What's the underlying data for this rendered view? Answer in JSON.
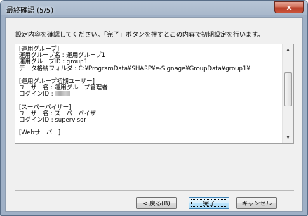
{
  "window": {
    "title": "最終確認 (5/5)",
    "close_label": "x"
  },
  "instruction": "設定内容を確認してください。「完了」ボタンを押すとこの内容で初期設定を行います。",
  "summary": {
    "lines": [
      "[運用グループ]",
      "運用グループ名 : 運用グループ1",
      "運用グループID : group1",
      "データ格納フォルダ : C:¥ProgramData¥SHARP¥e-Signage¥GroupData¥group1¥",
      "",
      "[運用グループ初期ユーザー]",
      "ユーザー名 : 運用グループ管理者",
      "ログインID :",
      "",
      "[スーパーバイザー]",
      "ユーザー名 : スーパーバイザー",
      "ログインID : supervisor",
      "",
      "[Webサーバー]"
    ]
  },
  "buttons": {
    "back": "< 戻る(B)",
    "finish": "完了",
    "cancel": "キャンセル"
  },
  "icons": {
    "scroll_up": "triangle-up",
    "scroll_down": "triangle-down"
  }
}
